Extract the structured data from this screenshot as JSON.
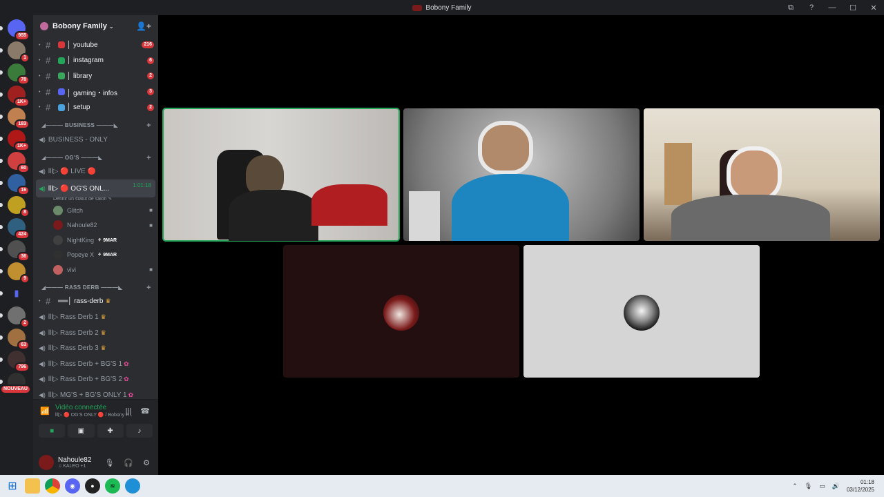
{
  "window": {
    "title": "Bobony Family",
    "controls": [
      "⧉",
      "?",
      "—",
      "☐",
      "✕"
    ]
  },
  "servers": [
    {
      "badge": "955",
      "color": "#5865f2"
    },
    {
      "badge": "1",
      "color": "#8a7a6a"
    },
    {
      "badge": "78",
      "color": "#3a7a3a"
    },
    {
      "badge": "1K+",
      "color": "#a02020"
    },
    {
      "badge": "183",
      "color": "#c08050"
    },
    {
      "badge": "1K+",
      "color": "#b01818"
    },
    {
      "badge": "60",
      "color": "#d04040"
    },
    {
      "badge": "16",
      "color": "#3060a0"
    },
    {
      "badge": "8",
      "color": "#c0a020"
    },
    {
      "badge": "424",
      "color": "#306080"
    },
    {
      "badge": "36",
      "color": "#505050"
    },
    {
      "badge": "9",
      "color": "#c09030"
    },
    {
      "badge": "",
      "color": "folder"
    },
    {
      "badge": "2",
      "color": "#707070"
    },
    {
      "badge": "63",
      "color": "#a07040"
    },
    {
      "badge": "796",
      "color": "#403030"
    },
    {
      "badge": "NOUVEAU",
      "color": "#303030"
    }
  ],
  "guild": {
    "name": "Bobony Family"
  },
  "channels": {
    "text": [
      {
        "name": "│ youtube",
        "badge": "216",
        "emoji_color": "#da373c"
      },
      {
        "name": "│ instagram",
        "badge": "6",
        "emoji_color": "#23a55a"
      },
      {
        "name": "│ library",
        "badge": "2",
        "emoji_color": "#3ba55d"
      },
      {
        "name": "│ gaming・infos",
        "badge": "3",
        "emoji_color": "#5865f2"
      },
      {
        "name": "│ setup",
        "badge": "2",
        "emoji_color": "#4aa3df"
      }
    ],
    "business_category": "◢——— BUSINESS ———◣",
    "business_channel": "BUSINESS - ONLY",
    "ogs_category": "◢——— OG'S ———◣",
    "live_channel": "lll▷ 🔴 LIVE 🔴",
    "active_channel": "lll▷ 🔴 OG'S ONL...",
    "active_timer": "1:01:18",
    "active_subtitle": "Définir un statut de salon ✎",
    "voice_users": [
      {
        "name": "Glitch",
        "tag": "",
        "cam": true,
        "color": "#6a8a6a"
      },
      {
        "name": "Nahoule82",
        "tag": "",
        "cam": true,
        "color": "#7a1a1a"
      },
      {
        "name": "NightKing",
        "tag": "⚘ 9MAR",
        "cam": false,
        "color": "#404040"
      },
      {
        "name": "Popeye X",
        "tag": "⚘ 9MAR",
        "cam": false,
        "color": "#303030"
      },
      {
        "name": "vivi",
        "tag": "",
        "cam": true,
        "color": "#c06060"
      }
    ],
    "rass_category": "◢——— RASS DERB ———◣",
    "rass_text": "══│ rass-derb",
    "rass_voice": [
      {
        "name": "lll▷ Rass Derb 1",
        "suffix": "crown"
      },
      {
        "name": "lll▷ Rass Derb 2",
        "suffix": "crown"
      },
      {
        "name": "lll▷ Rass Derb 3",
        "suffix": "crown"
      },
      {
        "name": "lll▷ Rass Derb + BG'S 1",
        "suffix": "pink"
      },
      {
        "name": "lll▷ Rass Derb + BG'S 2",
        "suffix": "pink"
      },
      {
        "name": "lll▷ MG'S + BG'S ONLY 1",
        "suffix": "pink"
      }
    ]
  },
  "voice_panel": {
    "status": "Vidéo connectée",
    "sub": "lll▷ 🔴 OG'S ONLY 🔴 / Bobony F..."
  },
  "user": {
    "name": "Nahoule82",
    "status": "♫ KALEO +1"
  },
  "taskbar": {
    "time": "01:18",
    "date": "03/12/2025"
  }
}
